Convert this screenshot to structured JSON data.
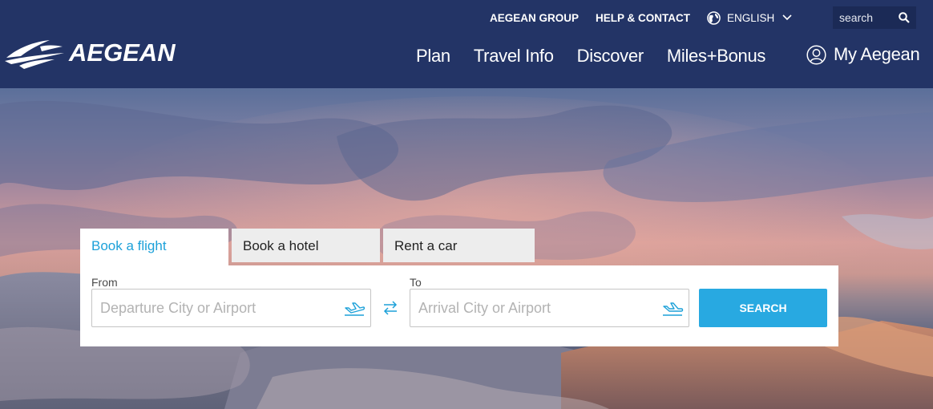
{
  "brand": {
    "name": "AEGEAN"
  },
  "top_links": {
    "group": "AEGEAN GROUP",
    "help": "HELP & CONTACT",
    "language": "ENGLISH"
  },
  "search": {
    "placeholder": "search"
  },
  "main_nav": {
    "items": [
      {
        "label": "Plan"
      },
      {
        "label": "Travel Info"
      },
      {
        "label": "Discover"
      },
      {
        "label": "Miles+Bonus"
      }
    ],
    "account": "My Aegean"
  },
  "booking": {
    "tabs": [
      {
        "label": "Book a flight",
        "active": true
      },
      {
        "label": "Book a hotel",
        "active": false
      },
      {
        "label": "Rent a car",
        "active": false
      }
    ],
    "from_label": "From",
    "from_placeholder": "Departure City or Airport",
    "to_label": "To",
    "to_placeholder": "Arrival City or Airport",
    "search_label": "SEARCH"
  },
  "icons": {
    "globe": "globe-icon",
    "chevron": "chevron-down-icon",
    "search": "search-icon",
    "user": "user-icon",
    "plane": "plane-icon",
    "swap": "swap-arrows-icon"
  },
  "colors": {
    "header_bg": "#233466",
    "accent": "#28a9e1",
    "active_tab_text": "#1da1d9"
  }
}
